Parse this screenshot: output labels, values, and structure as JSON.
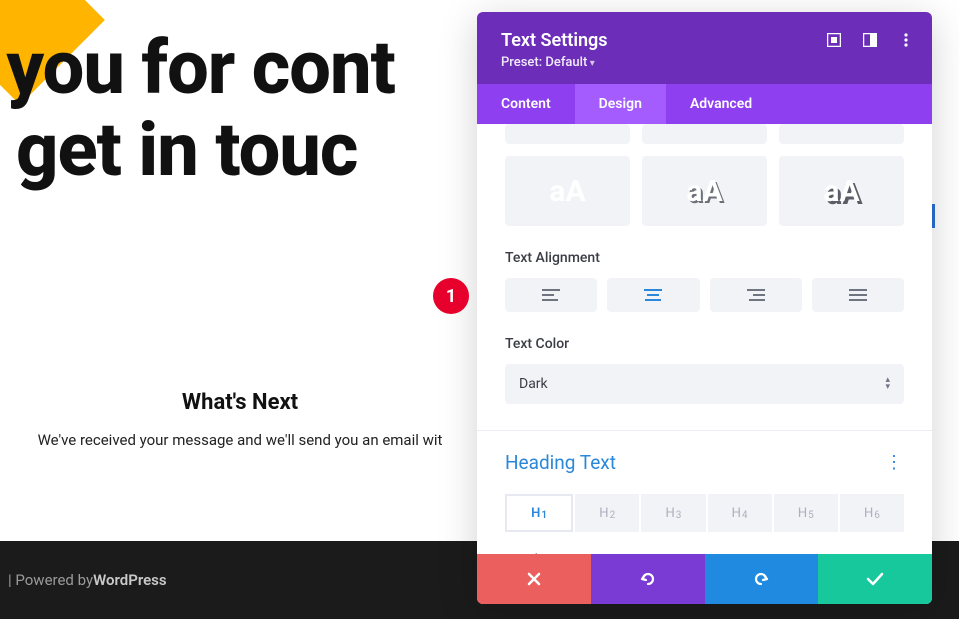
{
  "page": {
    "heading_line1": "k you for cont",
    "heading_line2": "'ll get in touc",
    "whats_next_title": "What's Next",
    "whats_next_body": "We've received your message and we'll send you an email wit",
    "footer_prefix": "| Powered by ",
    "footer_brand": "WordPress"
  },
  "panel": {
    "title": "Text Settings",
    "preset": "Preset: Default",
    "tabs": {
      "content": "Content",
      "design": "Design",
      "advanced": "Advanced"
    },
    "shadow_samples": {
      "label": "aA"
    },
    "text_alignment_label": "Text Alignment",
    "text_color_label": "Text Color",
    "text_color_value": "Dark",
    "heading_group_title": "Heading Text",
    "h_levels": [
      "1",
      "2",
      "3",
      "4",
      "5",
      "6"
    ],
    "heading_font_label": "Heading Font"
  },
  "marker": {
    "number": "1"
  }
}
